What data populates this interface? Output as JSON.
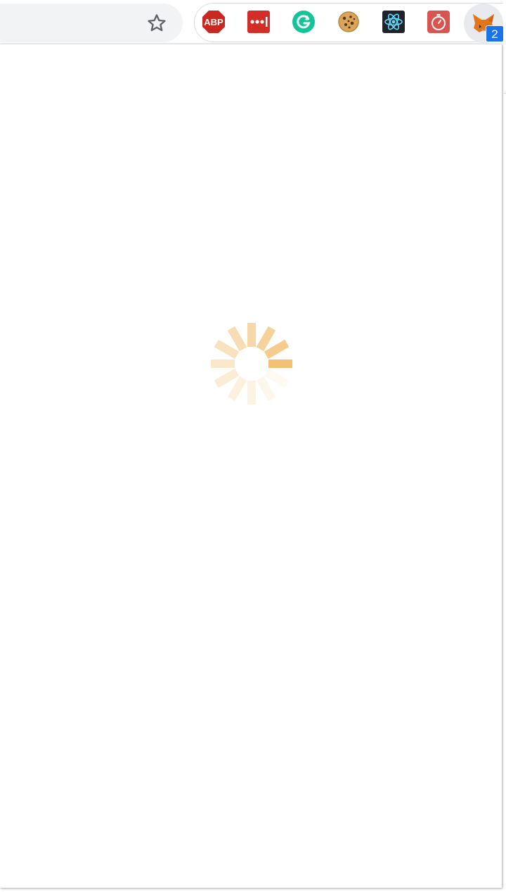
{
  "toolbar": {
    "bookmark_icon": "star-outline-icon",
    "extensions": [
      {
        "name": "adblock-plus",
        "label": "ABP",
        "color": "#c8281f"
      },
      {
        "name": "lastpass",
        "label": "•••|",
        "color": "#d32d27"
      },
      {
        "name": "grammarly",
        "label": "G",
        "color": "#15c39a"
      },
      {
        "name": "cookie-editor",
        "label": "",
        "color": "#c98a3c"
      },
      {
        "name": "react-devtools",
        "label": "",
        "color": "#20232a"
      },
      {
        "name": "timer",
        "label": "",
        "color": "#d9534f"
      },
      {
        "name": "metamask",
        "label": "",
        "color": "#e2761b"
      }
    ],
    "metamask_badge": "2"
  },
  "popup": {
    "state": "loading",
    "spinner_color": "#f0b65e"
  }
}
